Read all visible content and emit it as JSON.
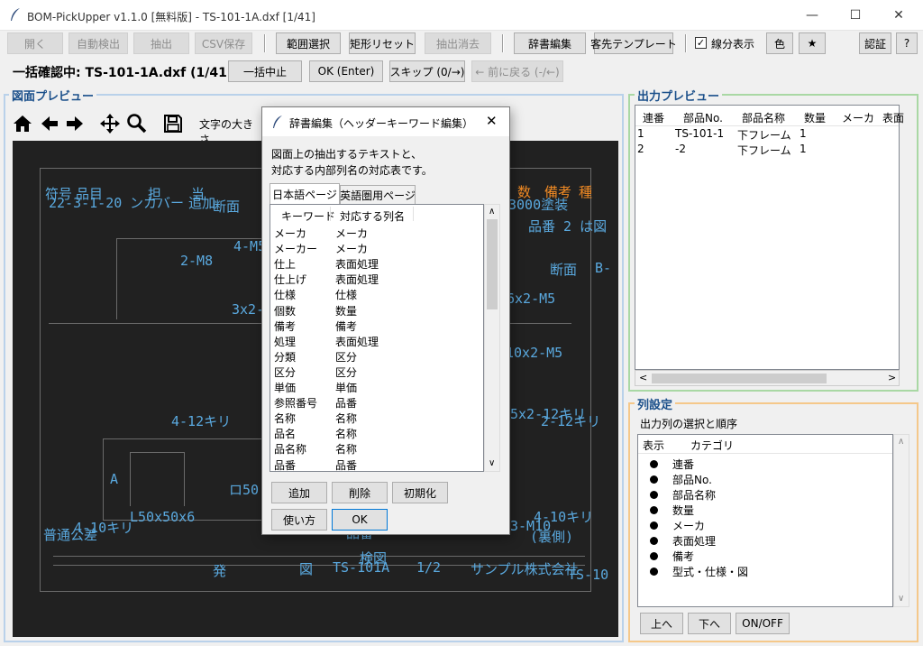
{
  "window": {
    "title": "BOM-PickUpper v1.1.0 [無料版] - TS-101-1A.dxf [1/41]",
    "minimize": "—",
    "maximize": "☐",
    "close": "✕"
  },
  "toolbar": {
    "open": "開く",
    "auto_detect": "自動検出",
    "extract": "抽出",
    "csv_save": "CSV保存",
    "range_select": "範囲選択",
    "rect_reset": "矩形リセット",
    "extract_clear": "抽出消去",
    "dict_edit": "辞書編集",
    "customer_template": "客先テンプレート",
    "line_display": "線分表示",
    "color": "色",
    "star": "★",
    "auth": "認証",
    "help": "?"
  },
  "status": {
    "text": "一括確認中: TS-101-1A.dxf (1/41)",
    "stop": "一括中止",
    "ok": "OK (Enter)",
    "skip": "スキップ (0/→)",
    "back": "← 前に戻る (-/←)"
  },
  "preview": {
    "title": "図面プレビュー",
    "font_size_label": "文字の大きさ",
    "cad_texts": [
      {
        "t": "符号",
        "c": "b"
      },
      {
        "t": "品目",
        "c": "b"
      },
      {
        "t": "担",
        "c": "b"
      },
      {
        "t": "当",
        "c": "b"
      },
      {
        "t": "22-3-1-20",
        "c": "b"
      },
      {
        "t": "ンカバー",
        "c": "b"
      },
      {
        "t": "追加",
        "c": "b"
      },
      {
        "t": "断面",
        "c": "b"
      },
      {
        "t": "数",
        "c": "o"
      },
      {
        "t": "備考",
        "c": "o"
      },
      {
        "t": "種",
        "c": "o"
      },
      {
        "t": "3000塗装",
        "c": "b"
      },
      {
        "t": "品番 2 は図",
        "c": "b"
      },
      {
        "t": "4-M5",
        "c": "b"
      },
      {
        "t": "2-M8",
        "c": "b"
      },
      {
        "t": "断面",
        "c": "b"
      },
      {
        "t": "B-",
        "c": "b"
      },
      {
        "t": "6x2-M5",
        "c": "b"
      },
      {
        "t": "3x2-",
        "c": "b"
      },
      {
        "t": "10x2-M5",
        "c": "b"
      },
      {
        "t": "4-12キリ",
        "c": "b"
      },
      {
        "t": "5x2-12キリ",
        "c": "b"
      },
      {
        "t": "2-12キリ",
        "c": "b"
      },
      {
        "t": "A",
        "c": "b"
      },
      {
        "t": "ロ50",
        "c": "b"
      },
      {
        "t": "L50x50x6",
        "c": "b"
      },
      {
        "t": "4-10キリ",
        "c": "b"
      },
      {
        "t": "普通公差",
        "c": "b"
      },
      {
        "t": "4-10キリ",
        "c": "b"
      },
      {
        "t": "3-M10",
        "c": "b"
      },
      {
        "t": "(裏側)",
        "c": "b"
      },
      {
        "t": "品番",
        "c": "b"
      },
      {
        "t": "TS-101A",
        "c": "b"
      },
      {
        "t": "検図",
        "c": "b"
      },
      {
        "t": "サンプル株式会社",
        "c": "b"
      },
      {
        "t": "TS-10",
        "c": "b"
      },
      {
        "t": "1/2",
        "c": "b"
      },
      {
        "t": "図",
        "c": "b"
      },
      {
        "t": "発",
        "c": "b"
      }
    ]
  },
  "dialog": {
    "title": "辞書編集（ヘッダーキーワード編集）",
    "close": "✕",
    "desc1": "図面上の抽出するテキストと、",
    "desc2": "対応する内部列名の対応表です。",
    "tab_ja": "日本語ページ",
    "tab_en": "英語圏用ページ",
    "col_keyword": "キーワード",
    "col_mapped": "対応する列名",
    "rows": [
      {
        "k": "メーカ",
        "v": "メーカ"
      },
      {
        "k": "メーカー",
        "v": "メーカ"
      },
      {
        "k": "仕上",
        "v": "表面処理"
      },
      {
        "k": "仕上げ",
        "v": "表面処理"
      },
      {
        "k": "仕様",
        "v": "仕様"
      },
      {
        "k": "個数",
        "v": "数量"
      },
      {
        "k": "備考",
        "v": "備考"
      },
      {
        "k": "処理",
        "v": "表面処理"
      },
      {
        "k": "分類",
        "v": "区分"
      },
      {
        "k": "区分",
        "v": "区分"
      },
      {
        "k": "単価",
        "v": "単価"
      },
      {
        "k": "参照番号",
        "v": "品番"
      },
      {
        "k": "名称",
        "v": "名称"
      },
      {
        "k": "品名",
        "v": "名称"
      },
      {
        "k": "品名称",
        "v": "名称"
      },
      {
        "k": "品番",
        "v": "品番"
      }
    ],
    "add": "追加",
    "delete": "削除",
    "init": "初期化",
    "howto": "使い方",
    "ok": "OK"
  },
  "output": {
    "title": "出力プレビュー",
    "headers": [
      "連番",
      "部品No.",
      "部品名称",
      "数量",
      "メーカ",
      "表面"
    ],
    "rows": [
      [
        "1",
        "TS-101-1",
        "下フレーム",
        "1"
      ],
      [
        "2",
        "-2",
        "下フレーム",
        "1"
      ]
    ]
  },
  "columns": {
    "title": "列設定",
    "subtitle": "出力列の選択と順序",
    "h_show": "表示",
    "h_category": "カテゴリ",
    "items": [
      "連番",
      "部品No.",
      "部品名称",
      "数量",
      "メーカ",
      "表面処理",
      "備考",
      "型式・仕様・図"
    ],
    "up": "上へ",
    "down": "下へ",
    "onoff": "ON/OFF"
  },
  "colors": {
    "cad_blue": "#5aa9df",
    "cad_orange": "#f08a24",
    "panel_green": "#a9d8a4",
    "panel_orange": "#f5c88a"
  }
}
